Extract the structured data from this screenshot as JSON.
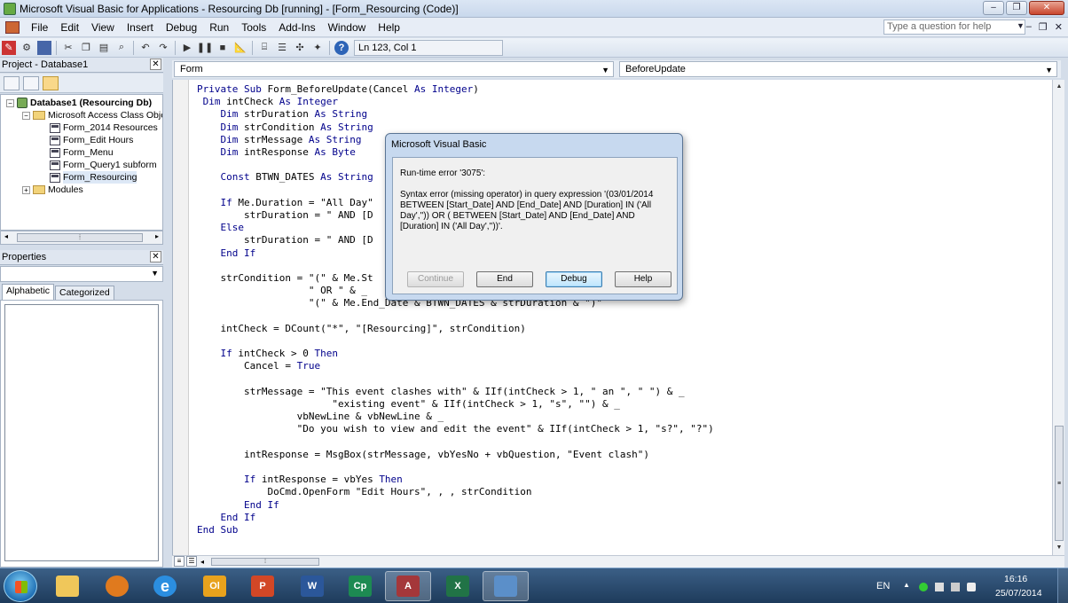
{
  "window": {
    "title": "Microsoft Visual Basic for Applications - Resourcing Db [running] - [Form_Resourcing (Code)]"
  },
  "menu": {
    "items": [
      {
        "label": "File",
        "key": "F"
      },
      {
        "label": "Edit",
        "key": "E"
      },
      {
        "label": "View",
        "key": "V"
      },
      {
        "label": "Insert",
        "key": "I"
      },
      {
        "label": "Debug",
        "key": "D"
      },
      {
        "label": "Run",
        "key": "R"
      },
      {
        "label": "Tools",
        "key": "T"
      },
      {
        "label": "Add-Ins",
        "key": "A"
      },
      {
        "label": "Window",
        "key": "W"
      },
      {
        "label": "Help",
        "key": "H"
      }
    ],
    "question_placeholder": "Type a question for help"
  },
  "toolbar": {
    "position": "Ln 123, Col 1"
  },
  "project": {
    "header": "Project - Database1",
    "tree": {
      "root": "Database1 (Resourcing Db)",
      "class_folder": "Microsoft Access Class Objects",
      "items": [
        "Form_2014 Resources",
        "Form_Edit Hours",
        "Form_Menu",
        "Form_Query1 subform",
        "Form_Resourcing"
      ],
      "modules_folder": "Modules"
    }
  },
  "properties": {
    "header": "Properties",
    "tabs": [
      "Alphabetic",
      "Categorized"
    ]
  },
  "code": {
    "object_combo": "Form",
    "procedure_combo": "BeforeUpdate",
    "lines": [
      "Private Sub Form_BeforeUpdate(Cancel As Integer)",
      " Dim intCheck As Integer",
      "    Dim strDuration As String",
      "    Dim strCondition As String",
      "    Dim strMessage As String",
      "    Dim intResponse As Byte",
      "",
      "    Const BTWN_DATES As String",
      "",
      "    If Me.Duration = \"All Day\"",
      "        strDuration = \" AND [D",
      "    Else",
      "        strDuration = \" AND [D",
      "    End If",
      "",
      "    strCondition = \"(\" & Me.St",
      "                   \" OR \" & _",
      "                   \"(\" & Me.End_Date & BTWN_DATES & strDuration & \")\"",
      "",
      "    intCheck = DCount(\"*\", \"[Resourcing]\", strCondition)",
      "",
      "    If intCheck > 0 Then",
      "        Cancel = True",
      "",
      "        strMessage = \"This event clashes with\" & IIf(intCheck > 1, \" an \", \" \") & _",
      "                       \"existing event\" & IIf(intCheck > 1, \"s\", \"\") & _",
      "                 vbNewLine & vbNewLine & _",
      "                 \"Do you wish to view and edit the event\" & IIf(intCheck > 1, \"s?\", \"?\")",
      "",
      "        intResponse = MsgBox(strMessage, vbYesNo + vbQuestion, \"Event clash\")",
      "",
      "        If intResponse = vbYes Then",
      "            DoCmd.OpenForm \"Edit Hours\", , , strCondition",
      "        End If",
      "    End If",
      "End Sub"
    ]
  },
  "dialog": {
    "title": "Microsoft Visual Basic",
    "error": "Run-time error '3075':",
    "message": "Syntax error (missing operator) in query expression '(03/01/2014 BETWEEN [Start_Date] AND [End_Date] AND [Duration] IN ('All Day','')) OR ( BETWEEN [Start_Date] AND [End_Date] AND [Duration] IN ('All Day',''))'.",
    "buttons": {
      "continue": "Continue",
      "end": "End",
      "debug": "Debug",
      "help": "Help"
    }
  },
  "taskbar": {
    "apps": [
      {
        "name": "explorer",
        "label": ""
      },
      {
        "name": "media-player",
        "label": ""
      },
      {
        "name": "internet-explorer",
        "label": "e"
      },
      {
        "name": "outlook",
        "label": "Ol"
      },
      {
        "name": "powerpoint",
        "label": "P"
      },
      {
        "name": "word",
        "label": "W"
      },
      {
        "name": "publisher",
        "label": "Cp"
      },
      {
        "name": "access",
        "label": "A"
      },
      {
        "name": "excel",
        "label": "X"
      },
      {
        "name": "remote-desktop",
        "label": ""
      }
    ],
    "language": "EN",
    "time": "16:16",
    "date": "25/07/2014"
  },
  "colors": {
    "keyword": "#00008b",
    "taskbar": "#2a4a6e"
  }
}
